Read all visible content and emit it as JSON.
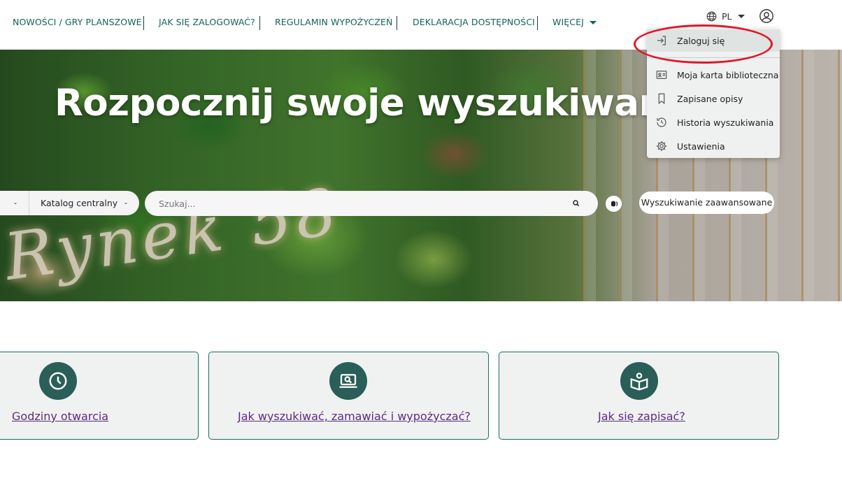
{
  "nav": {
    "items": [
      {
        "label": "NOWOŚCI / GRY PLANSZOWE"
      },
      {
        "label": "JAK SIĘ ZALOGOWAĆ?"
      },
      {
        "label": "REGULAMIN WYPOŻYCZEŃ"
      },
      {
        "label": "DEKLARACJA DOSTĘPNOŚCI"
      },
      {
        "label": "WIĘCEJ"
      }
    ],
    "language": "PL",
    "icons": {
      "language": "globe-icon",
      "user": "user-circle-icon",
      "more": "caret-down-icon"
    }
  },
  "hero": {
    "title": "Rozpocznij swoje wyszukiwanie",
    "scope_select_value": "",
    "catalog_select_value": "Katalog centralny",
    "search": {
      "placeholder": "Szukaj...",
      "value": ""
    },
    "advanced_search_label": "Wyszukiwanie zaawansowane",
    "icons": {
      "search": "search-icon",
      "voice": "voice-search-icon"
    }
  },
  "user_menu": {
    "items": [
      {
        "label": "Zaloguj się",
        "icon": "login-icon"
      },
      {
        "label": "Moja karta biblioteczna",
        "icon": "library-card-icon"
      },
      {
        "label": "Zapisane opisy",
        "icon": "bookmark-icon"
      },
      {
        "label": "Historia wyszukiwania",
        "icon": "history-icon"
      },
      {
        "label": "Ustawienia",
        "icon": "settings-icon"
      }
    ],
    "highlight_color": "#e0182a"
  },
  "cards": [
    {
      "label": "Godziny otwarcia",
      "icon": "clock-icon"
    },
    {
      "label": "Jak wyszukiwać, zamawiać i wypożyczać?",
      "icon": "laptop-search-icon"
    },
    {
      "label": "Jak się zapisać?",
      "icon": "book-reader-icon"
    }
  ],
  "colors": {
    "nav_text": "#16615a",
    "card_border": "#1e6b63",
    "card_icon_bg": "#2a5e58",
    "link": "#5e2a86"
  }
}
